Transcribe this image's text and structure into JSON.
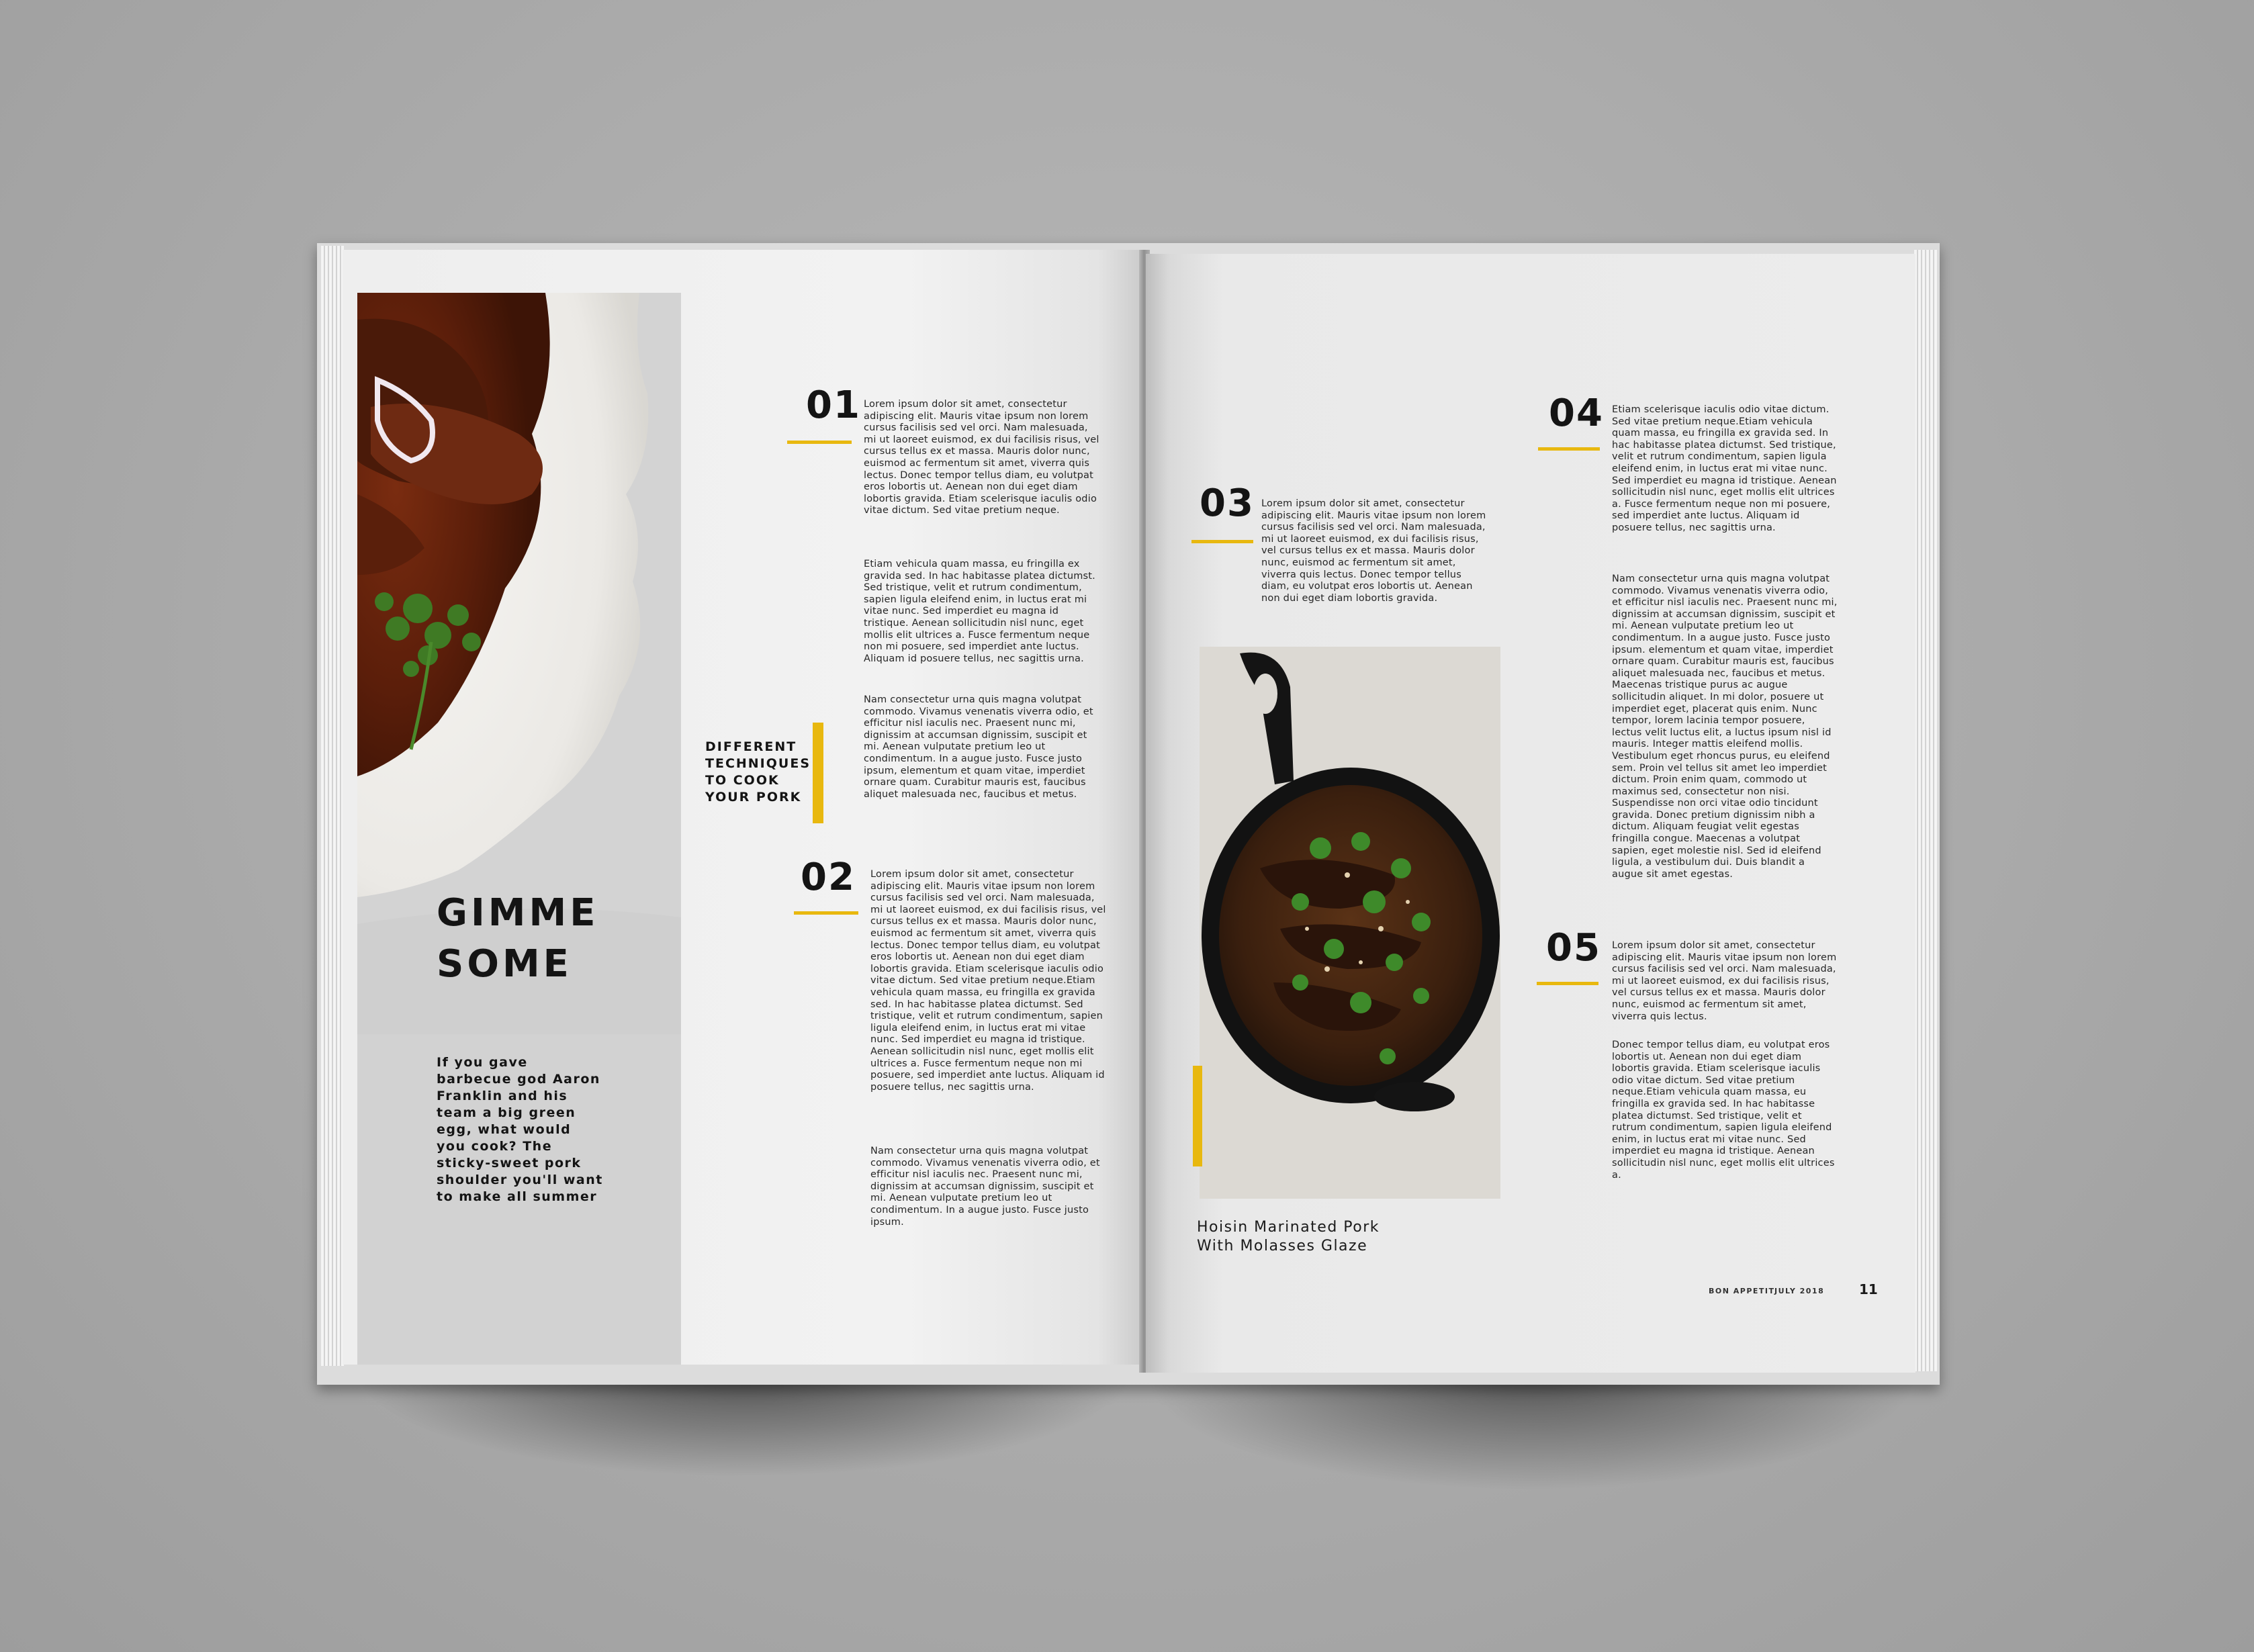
{
  "left_page": {
    "title_line1": "GIMME",
    "title_line2": "SOME",
    "intro": "If you gave barbecue god Aaron Franklin and his team a big green egg, what would you cook? The sticky-sweet pork shoulder you'll want to make all summer",
    "pull_quote": [
      "DIFFERENT",
      "TECHNIQUES",
      "TO COOK",
      "YOUR PORK"
    ],
    "sections": [
      {
        "number": "01",
        "paragraphs": [
          "Lorem ipsum dolor sit amet, consectetur adipiscing elit. Mauris vitae ipsum non lorem cursus facilisis sed vel orci. Nam malesuada, mi ut laoreet euismod, ex dui facilisis risus, vel cursus tellus ex et massa. Mauris dolor nunc, euismod ac fermentum sit amet, viverra quis lectus. Donec tempor tellus diam, eu volutpat eros lobortis ut. Aenean non dui eget diam lobortis gravida. Etiam scelerisque iaculis odio vitae dictum. Sed vitae pretium neque.",
          "Etiam vehicula quam massa, eu fringilla ex gravida sed. In hac habitasse platea dictumst. Sed tristique, velit et rutrum condimentum, sapien ligula eleifend enim, in luctus erat mi vitae nunc. Sed imperdiet eu magna id tristique. Aenean sollicitudin nisl nunc, eget mollis elit ultrices a. Fusce fermentum neque non mi posuere, sed imperdiet ante luctus. Aliquam id posuere tellus, nec sagittis urna.",
          "Nam consectetur urna quis magna volutpat commodo. Vivamus venenatis viverra odio, et efficitur nisl iaculis nec. Praesent nunc mi, dignissim at accumsan dignissim, suscipit et mi. Aenean vulputate pretium leo ut condimentum. In a augue justo. Fusce justo ipsum, elementum et quam vitae, imperdiet ornare quam. Curabitur mauris est, faucibus aliquet malesuada nec, faucibus et metus."
        ]
      },
      {
        "number": "02",
        "paragraphs": [
          "Lorem ipsum dolor sit amet, consectetur adipiscing elit. Mauris vitae ipsum non lorem cursus facilisis sed vel orci. Nam malesuada, mi ut laoreet euismod, ex dui facilisis risus, vel cursus tellus ex et massa. Mauris dolor nunc, euismod ac fermentum sit amet, viverra quis lectus. Donec tempor tellus diam, eu volutpat eros lobortis ut. Aenean non dui eget diam lobortis gravida. Etiam scelerisque iaculis odio vitae dictum. Sed vitae pretium neque.Etiam vehicula quam massa, eu fringilla ex gravida sed. In hac habitasse platea dictumst. Sed tristique, velit et rutrum condimentum, sapien ligula eleifend enim, in luctus erat mi vitae nunc. Sed imperdiet eu magna id tristique. Aenean sollicitudin nisl nunc, eget mollis elit ultrices a. Fusce fermentum neque non mi posuere, sed imperdiet ante luctus. Aliquam id posuere tellus, nec sagittis urna.",
          "Nam consectetur urna quis magna volutpat commodo. Vivamus venenatis viverra odio, et efficitur nisl iaculis nec. Praesent nunc mi, dignissim at accumsan dignissim, suscipit et mi. Aenean vulputate pretium leo ut condimentum. In a augue justo. Fusce justo ipsum."
        ]
      }
    ]
  },
  "right_page": {
    "sections": [
      {
        "number": "03",
        "paragraphs": [
          "Lorem ipsum dolor sit amet, consectetur adipiscing elit. Mauris vitae ipsum non lorem cursus facilisis sed vel orci. Nam malesuada, mi ut laoreet euismod, ex dui facilisis risus, vel cursus tellus ex et massa. Mauris dolor nunc, euismod ac fermentum sit amet, viverra quis lectus. Donec tempor tellus diam, eu volutpat eros lobortis ut. Aenean non dui eget diam lobortis gravida."
        ]
      },
      {
        "number": "04",
        "paragraphs": [
          "Etiam scelerisque iaculis odio vitae dictum. Sed vitae pretium neque.Etiam vehicula quam massa, eu fringilla ex gravida sed. In hac habitasse platea dictumst. Sed tristique, velit et rutrum condimentum, sapien ligula eleifend enim, in luctus erat mi vitae nunc. Sed imperdiet eu magna id tristique. Aenean sollicitudin nisl nunc, eget mollis elit ultrices a. Fusce fermentum neque non mi posuere, sed imperdiet ante luctus. Aliquam id posuere tellus, nec sagittis urna.",
          "Nam consectetur urna quis magna volutpat commodo. Vivamus venenatis viverra odio, et efficitur nisl iaculis nec. Praesent nunc mi, dignissim at accumsan dignissim, suscipit et mi. Aenean vulputate pretium leo ut condimentum. In a augue justo. Fusce justo ipsum. elementum et quam vitae, imperdiet ornare quam. Curabitur mauris est, faucibus aliquet malesuada nec, faucibus et metus. Maecenas tristique purus ac augue sollicitudin aliquet. In mi dolor, posuere ut imperdiet eget, placerat quis enim. Nunc tempor, lorem lacinia tempor posuere, lectus velit luctus elit, a luctus ipsum nisl id mauris. Integer mattis eleifend mollis. Vestibulum eget rhoncus purus, eu eleifend sem. Proin vel tellus sit amet leo imperdiet dictum. Proin enim quam, commodo ut maximus sed, consectetur non nisi. Suspendisse non orci vitae odio tincidunt gravida. Donec pretium dignissim nibh a dictum. Aliquam feugiat velit egestas fringilla congue. Maecenas a volutpat sapien, eget molestie nisl. Sed id eleifend ligula, a vestibulum dui. Duis blandit a augue sit amet egestas."
        ]
      },
      {
        "number": "05",
        "paragraphs": [
          "Lorem ipsum dolor sit amet, consectetur adipiscing elit. Mauris vitae ipsum non lorem cursus facilisis sed vel orci. Nam malesuada, mi ut laoreet euismod, ex dui facilisis risus, vel cursus tellus ex et massa. Mauris dolor nunc, euismod ac fermentum sit amet, viverra quis lectus.",
          "Donec tempor tellus diam, eu volutpat eros lobortis ut. Aenean non dui eget diam lobortis gravida. Etiam scelerisque iaculis odio vitae dictum. Sed vitae pretium neque.Etiam vehicula quam massa, eu fringilla ex gravida sed. In hac habitasse platea dictumst. Sed tristique, velit et rutrum condimentum, sapien ligula eleifend enim, in luctus erat mi vitae nunc. Sed imperdiet eu magna id tristique. Aenean sollicitudin nisl nunc, eget mollis elit ultrices a."
        ]
      }
    ],
    "caption_line1": "Hoisin Marinated Pork",
    "caption_line2": "With Molasses Glaze",
    "footer_magazine": "BON APPETIT",
    "footer_date": "JULY 2018",
    "page_number": "11"
  },
  "colors": {
    "accent": "#e8b80f",
    "ink": "#141414",
    "paper": "#ececec",
    "background": "#aaaaaa"
  }
}
